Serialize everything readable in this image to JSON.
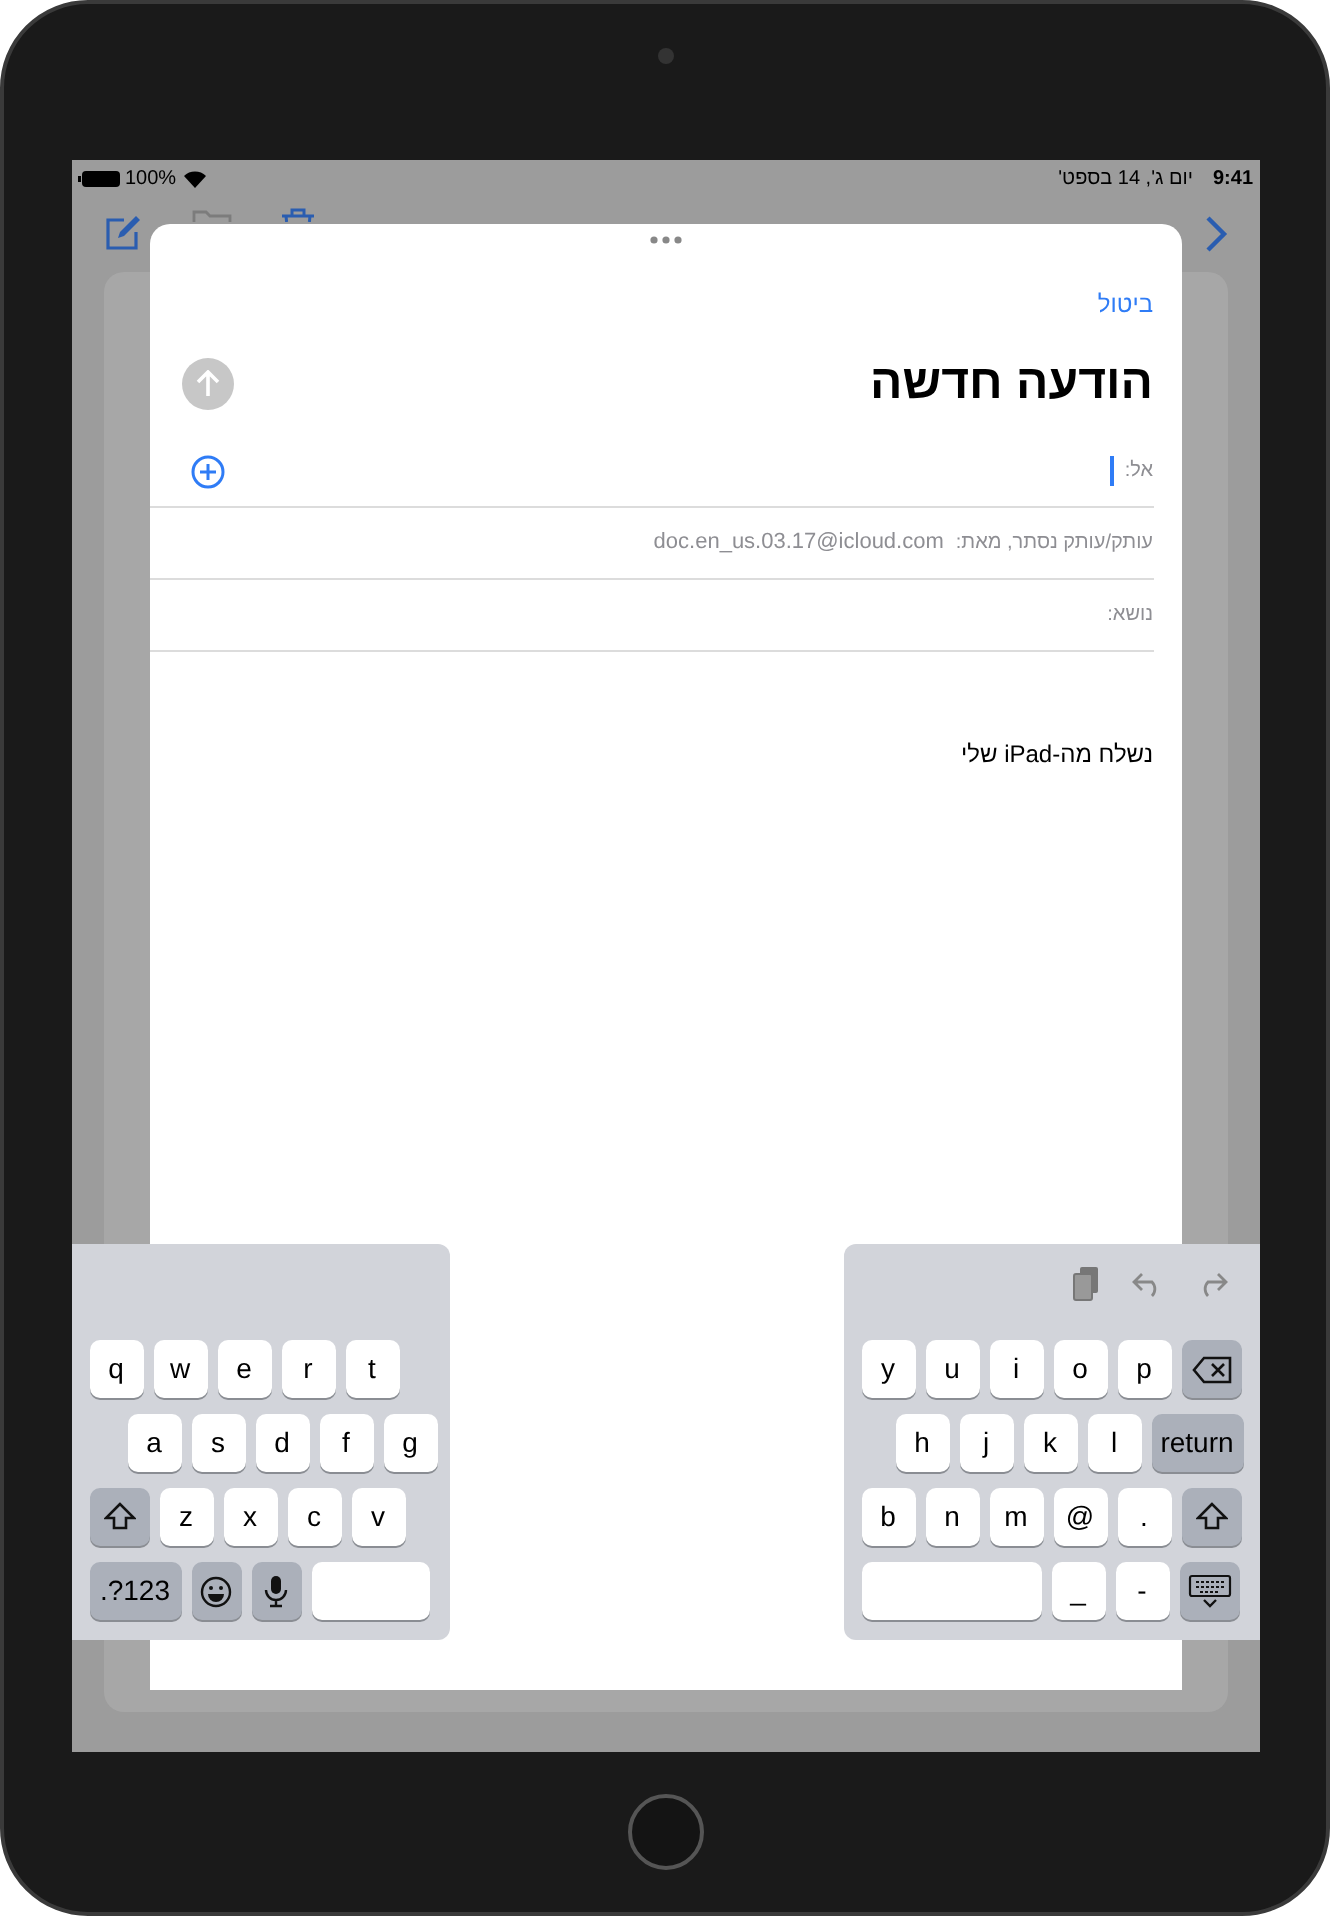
{
  "status_bar": {
    "battery": "100%",
    "date": "יום ג', 14 בספט'",
    "time": "9:41"
  },
  "compose": {
    "cancel": "ביטול",
    "title": "הודעה חדשה",
    "fields": [
      {
        "kind": "to",
        "label": "אל:"
      },
      {
        "kind": "from",
        "label": "עותק/עותק נסתר, מאת:",
        "value": "doc.en_us.03.17@icloud.com"
      },
      {
        "kind": "subject",
        "label": "נושא:"
      }
    ],
    "body": "נשלח מה-iPad שלי"
  },
  "keyboard_left": {
    "key_rows": [
      {
        "keys": [
          {
            "kind": "letter",
            "label": "t"
          },
          {
            "kind": "letter",
            "label": "r"
          },
          {
            "kind": "letter",
            "label": "e"
          },
          {
            "kind": "letter",
            "label": "w"
          },
          {
            "kind": "letter",
            "label": "q"
          }
        ]
      },
      {
        "keys": [
          {
            "kind": "letter",
            "label": "g"
          },
          {
            "kind": "letter",
            "label": "f"
          },
          {
            "kind": "letter",
            "label": "d"
          },
          {
            "kind": "letter",
            "label": "s"
          },
          {
            "kind": "letter",
            "label": "a"
          }
        ]
      },
      {
        "keys": [
          {
            "kind": "letter",
            "label": "v"
          },
          {
            "kind": "letter",
            "label": "c"
          },
          {
            "kind": "letter",
            "label": "x"
          },
          {
            "kind": "letter",
            "label": "z"
          },
          {
            "kind": "shift"
          }
        ]
      },
      {
        "keys": [
          {
            "kind": "space"
          },
          {
            "kind": "mic"
          },
          {
            "kind": "emoji"
          },
          {
            "kind": "numbers",
            "label": ".?123"
          }
        ]
      }
    ]
  },
  "keyboard_right": {
    "key_rows": [
      {
        "keys": [
          {
            "kind": "delete"
          },
          {
            "kind": "letter",
            "label": "p"
          },
          {
            "kind": "letter",
            "label": "o"
          },
          {
            "kind": "letter",
            "label": "i"
          },
          {
            "kind": "letter",
            "label": "u"
          },
          {
            "kind": "letter",
            "label": "y"
          }
        ]
      },
      {
        "keys": [
          {
            "kind": "return",
            "label": "return"
          },
          {
            "kind": "letter",
            "label": "l"
          },
          {
            "kind": "letter",
            "label": "k"
          },
          {
            "kind": "letter",
            "label": "j"
          },
          {
            "kind": "letter",
            "label": "h"
          }
        ]
      },
      {
        "keys": [
          {
            "kind": "shift"
          },
          {
            "kind": "letter",
            "label": "."
          },
          {
            "kind": "letter",
            "label": "@"
          },
          {
            "kind": "letter",
            "label": "m"
          },
          {
            "kind": "letter",
            "label": "n"
          },
          {
            "kind": "letter",
            "label": "b"
          }
        ]
      },
      {
        "keys": [
          {
            "kind": "hide"
          },
          {
            "kind": "letter",
            "label": "-"
          },
          {
            "kind": "letter",
            "label": "_"
          },
          {
            "kind": "space"
          }
        ]
      }
    ]
  }
}
